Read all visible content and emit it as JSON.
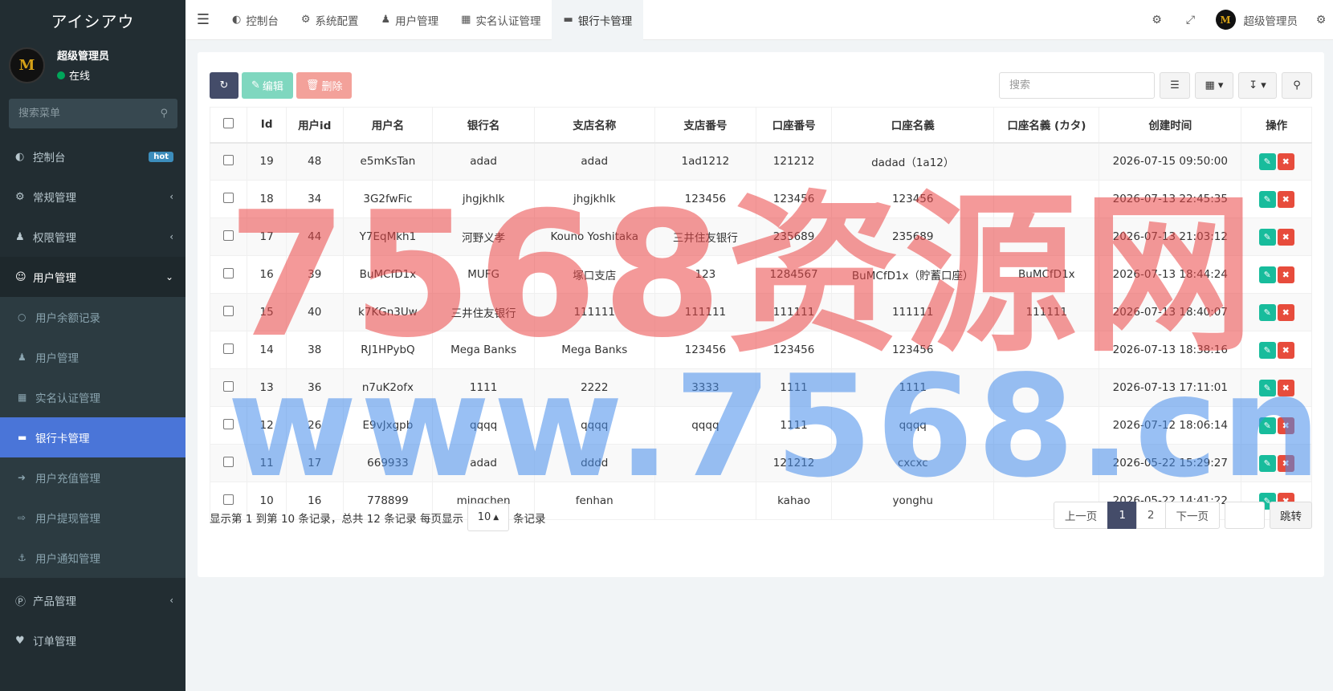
{
  "app": {
    "brand": "アイシアウ",
    "avatar_letter": "M"
  },
  "user": {
    "name": "超级管理员",
    "status": "在线"
  },
  "sidebar": {
    "search_placeholder": "搜索菜单",
    "items": [
      {
        "label": "控制台",
        "icon": "dashboard-icon",
        "badge": "hot"
      },
      {
        "label": "常规管理",
        "icon": "cogs-icon"
      },
      {
        "label": "权限管理",
        "icon": "users-icon"
      },
      {
        "label": "用户管理",
        "icon": "user-circle-icon"
      }
    ],
    "sub_items": [
      {
        "label": "用户余额记录",
        "icon": "circle-icon"
      },
      {
        "label": "用户管理",
        "icon": "user-icon"
      },
      {
        "label": "实名认证管理",
        "icon": "id-card-icon"
      },
      {
        "label": "银行卡管理",
        "icon": "credit-card-icon"
      },
      {
        "label": "用户充值管理",
        "icon": "sign-in-icon"
      },
      {
        "label": "用户提现管理",
        "icon": "sign-out-icon"
      },
      {
        "label": "用户通知管理",
        "icon": "anchor-icon"
      }
    ],
    "bottom_items": [
      {
        "label": "产品管理",
        "icon": "product-icon"
      },
      {
        "label": "订单管理",
        "icon": "heartbeat-icon"
      }
    ]
  },
  "topbar": {
    "tabs": [
      {
        "label": "控制台",
        "icon": "dashboard-icon"
      },
      {
        "label": "系统配置",
        "icon": "cog-icon"
      },
      {
        "label": "用户管理",
        "icon": "user-icon"
      },
      {
        "label": "实名认证管理",
        "icon": "id-card-icon"
      },
      {
        "label": "银行卡管理",
        "icon": "credit-card-icon"
      }
    ],
    "user_name": "超级管理员"
  },
  "toolbar": {
    "edit_label": "编辑",
    "delete_label": "删除",
    "search_placeholder": "搜索"
  },
  "table": {
    "headers": [
      "Id",
      "用户id",
      "用户名",
      "银行名",
      "支店名称",
      "支店番号",
      "口座番号",
      "口座名義",
      "口座名義 (カタ)",
      "创建时间",
      "操作"
    ],
    "rows": [
      [
        "19",
        "48",
        "e5mKsTan",
        "adad",
        "adad",
        "1ad1212",
        "121212",
        "dadad（1a12）",
        "",
        "2026-07-15 09:50:00"
      ],
      [
        "18",
        "34",
        "3G2fwFic",
        "jhgjkhlk",
        "jhgjkhlk",
        "123456",
        "123456",
        "123456",
        "",
        "2026-07-13 22:45:35"
      ],
      [
        "17",
        "44",
        "Y7EqMkh1",
        "河野义孝",
        "Kouno Yoshitaka",
        "三井住友银行",
        "235689",
        "235689",
        "",
        "2026-07-13 21:03:12"
      ],
      [
        "16",
        "39",
        "BuMCfD1x",
        "MUFG",
        "塚口支店",
        "123",
        "1284567",
        "BuMCfD1x（貯蓄口座）",
        "BuMCfD1x",
        "2026-07-13 18:44:24"
      ],
      [
        "15",
        "40",
        "k7KGn3Uw",
        "三井住友银行",
        "111111",
        "111111",
        "111111",
        "111111",
        "111111",
        "2026-07-13 18:40:07"
      ],
      [
        "14",
        "38",
        "RJ1HPybQ",
        "Mega Banks",
        "Mega Banks",
        "123456",
        "123456",
        "123456",
        "",
        "2026-07-13 18:38:16"
      ],
      [
        "13",
        "36",
        "n7uK2ofx",
        "1111",
        "2222",
        "3333",
        "1111",
        "1111",
        "",
        "2026-07-13 17:11:01"
      ],
      [
        "12",
        "26",
        "E9vJxgpb",
        "qqqq",
        "qqqq",
        "qqqq",
        "1111",
        "qqqq",
        "",
        "2026-07-12 18:06:14"
      ],
      [
        "11",
        "17",
        "669933",
        "adad",
        "dddd",
        "",
        "121212",
        "cxcxc",
        "",
        "2026-05-22 15:29:27"
      ],
      [
        "10",
        "16",
        "778899",
        "mingchen",
        "fenhan",
        "",
        "kahao",
        "yonghu",
        "",
        "2026-05-22 14:41:22"
      ]
    ]
  },
  "footer": {
    "info_prefix": "显示第 1 到第 10 条记录，总共 12 条记录 每页显示",
    "page_size": "10",
    "info_suffix": "条记录",
    "prev": "上一页",
    "pages": [
      "1",
      "2"
    ],
    "next": "下一页",
    "jump": "跳转"
  },
  "watermark": {
    "line1": "7568资源网",
    "line2": "www.7568.cn"
  }
}
